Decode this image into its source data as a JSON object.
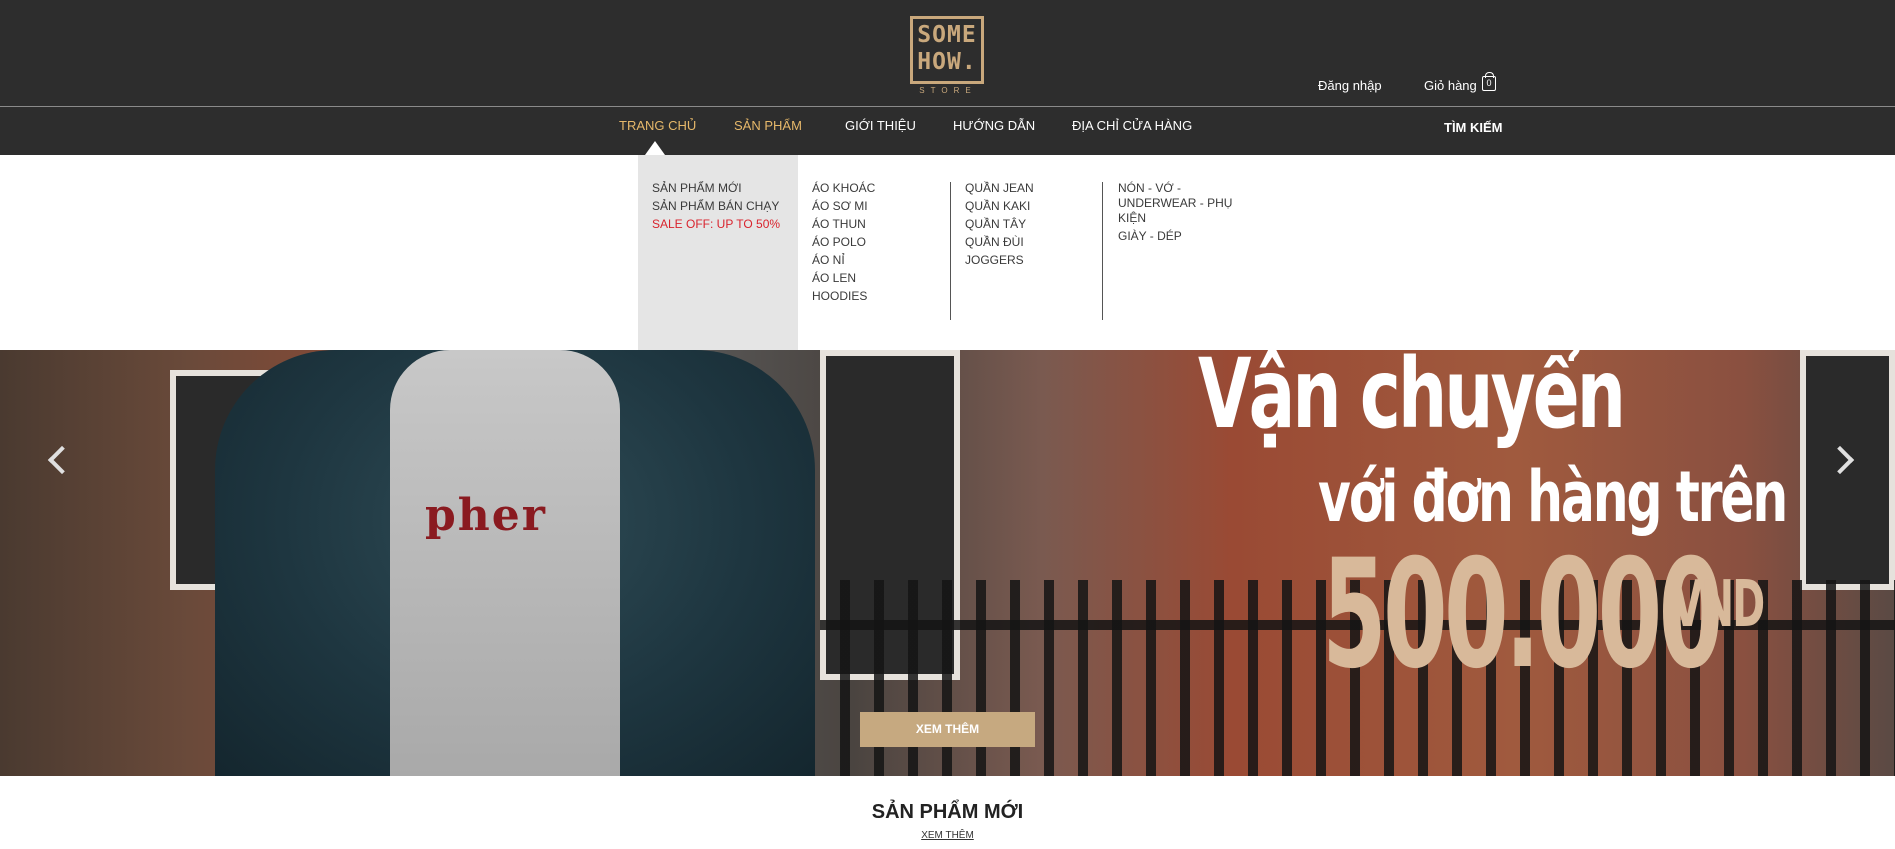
{
  "header": {
    "logo": {
      "line1": "SOME",
      "line2": "HOW.",
      "sub": "STORE"
    },
    "login_label": "Đăng nhập",
    "cart_label": "Giỏ hàng",
    "cart_count": "0"
  },
  "nav": {
    "items": [
      {
        "label": "TRANG CHỦ",
        "active": true
      },
      {
        "label": "SẢN PHẨM",
        "active": true
      },
      {
        "label": "GIỚI THIỆU",
        "active": false
      },
      {
        "label": "HƯỚNG DẪN",
        "active": false
      },
      {
        "label": "ĐỊA CHỈ CỬA HÀNG",
        "active": false
      }
    ],
    "search_label": "TÌM KIẾM"
  },
  "mega_menu": {
    "col1": [
      "SẢN PHẨM MỚI",
      "SẢN PHẨM BÁN CHẠY",
      "SALE OFF: UP TO 50%"
    ],
    "col2": [
      "ÁO KHOÁC",
      "ÁO SƠ MI",
      "ÁO THUN",
      "ÁO POLO",
      "ÁO NỈ",
      "ÁO LEN",
      "HOODIES"
    ],
    "col3": [
      "QUẦN JEAN",
      "QUẦN KAKI",
      "QUẦN TÂY",
      "QUẦN ĐÙI",
      "JOGGERS"
    ],
    "col4": [
      "NÓN - VỚ -",
      "UNDERWEAR - PHỤ",
      "KIỆN",
      "GIÀY - DÉP"
    ]
  },
  "banner": {
    "line1": "Vận chuyển",
    "line2": "với đơn hàng trên",
    "amount": "500.000",
    "currency": "VND",
    "button_label": "XEM THÊM",
    "shirt_text": "pher"
  },
  "section": {
    "title": "SẢN PHẨM MỚI",
    "more_label": "XEM THÊM"
  },
  "colors": {
    "header_bg": "#2d2d2d",
    "accent_gold": "#c9a87c",
    "nav_active": "#e6b86a",
    "sale_red": "#d9232d"
  }
}
